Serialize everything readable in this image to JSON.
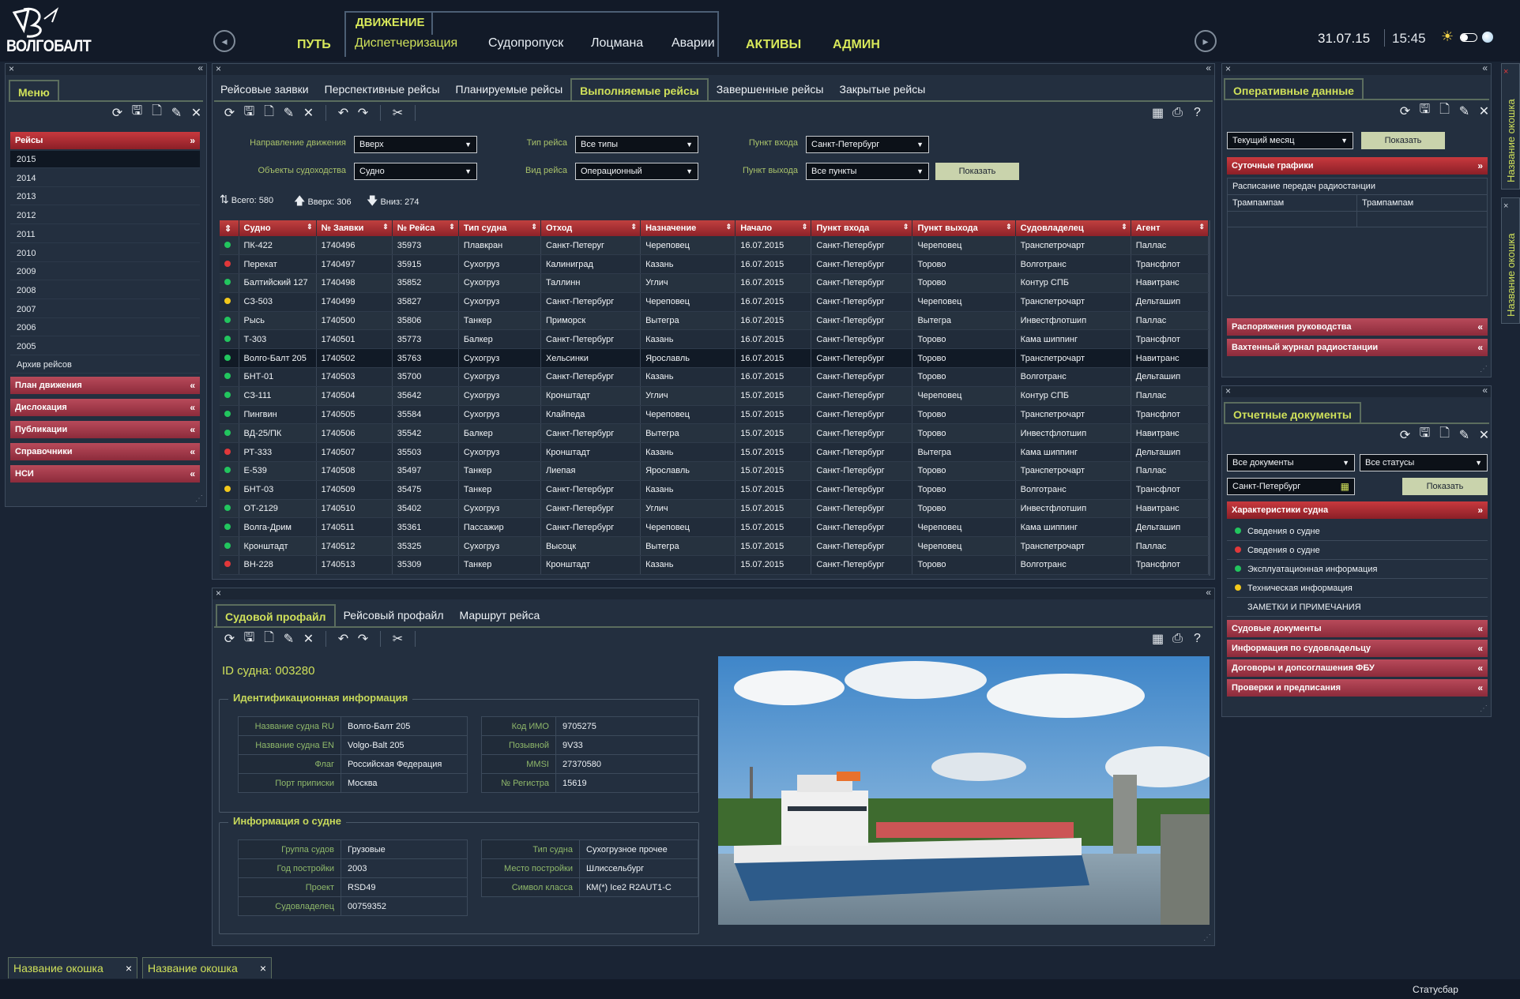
{
  "app": {
    "logo_text": "ВОЛГОБАЛТ",
    "date": "31.07.15",
    "time": "15:45"
  },
  "topnav": {
    "main": [
      "ПУТЬ",
      "АКТИВЫ",
      "АДМИН"
    ],
    "movement": {
      "label": "ДВИЖЕНИЕ",
      "subitems": [
        "Диспетчеризация",
        "Судопропуск",
        "Лоцмана",
        "Аварии"
      ]
    }
  },
  "menu": {
    "tab": "Меню",
    "trips": {
      "label": "Рейсы",
      "years": [
        "2015",
        "2014",
        "2013",
        "2012",
        "2011",
        "2010",
        "2009",
        "2008",
        "2007",
        "2006",
        "2005"
      ],
      "archive": "Архив рейсов"
    },
    "sections": [
      "План движения",
      "Дислокация",
      "Публикации",
      "Справочники",
      "НСИ"
    ]
  },
  "main": {
    "tabs": [
      "Рейсовые заявки",
      "Перспективные рейсы",
      "Планируемые рейсы",
      "Выполняемые рейсы",
      "Завершенные рейсы",
      "Закрытые рейсы"
    ],
    "active_tab": 3,
    "filters": {
      "direction_label": "Направление движения",
      "direction": "Вверх",
      "objects_label": "Объекты судоходства",
      "objects": "Судно",
      "triptype_label": "Тип рейса",
      "triptype": "Все типы",
      "tripkind_label": "Вид рейса",
      "tripkind": "Операционный",
      "entry_label": "Пункт входа",
      "entry": "Санкт-Петербург",
      "exit_label": "Пункт выхода",
      "exit": "Все пункты",
      "show": "Показать"
    },
    "counts": {
      "total": "Всего: 580",
      "up": "Вверх: 306",
      "down": "Вниз: 274"
    },
    "columns": [
      "Судно",
      "№ Заявки",
      "№ Рейса",
      "Тип судна",
      "Отход",
      "Назначение",
      "Начало",
      "Пункт входа",
      "Пункт выхода",
      "Судовладелец",
      "Агент"
    ],
    "rows": [
      {
        "s": "g",
        "c": [
          "ПК-422",
          "1740496",
          "35973",
          "Плавкран",
          "Санкт-Петеруг",
          "Череповец",
          "16.07.2015",
          "Санкт-Петербург",
          "Череповец",
          "Транспетрочарт",
          "Паллас"
        ]
      },
      {
        "s": "r",
        "c": [
          "Перекат",
          "1740497",
          "35915",
          "Сухогруз",
          "Калиниград",
          "Казань",
          "16.07.2015",
          "Санкт-Петербург",
          "Торово",
          "Волготранс",
          "Трансфлот"
        ]
      },
      {
        "s": "g",
        "c": [
          "Балтийский 127",
          "1740498",
          "35852",
          "Сухогруз",
          "Таллинн",
          "Углич",
          "16.07.2015",
          "Санкт-Петербург",
          "Торово",
          "Контур СПБ",
          "Навитранс"
        ]
      },
      {
        "s": "y",
        "c": [
          "СЗ-503",
          "1740499",
          "35827",
          "Сухогруз",
          "Санкт-Петербург",
          "Череповец",
          "16.07.2015",
          "Санкт-Петербург",
          "Череповец",
          "Транспетрочарт",
          "Дельташип"
        ]
      },
      {
        "s": "g",
        "c": [
          "Рысь",
          "1740500",
          "35806",
          "Танкер",
          "Приморск",
          "Вытегра",
          "16.07.2015",
          "Санкт-Петербург",
          "Вытегра",
          "Инвестфлотшип",
          "Паллас"
        ]
      },
      {
        "s": "g",
        "c": [
          "Т-303",
          "1740501",
          "35773",
          "Балкер",
          "Санкт-Петербург",
          "Казань",
          "16.07.2015",
          "Санкт-Петербург",
          "Торово",
          "Кама шиппинг",
          "Трансфлот"
        ]
      },
      {
        "s": "g",
        "c": [
          "Волго-Балт 205",
          "1740502",
          "35763",
          "Сухогруз",
          "Хельсинки",
          "Ярославль",
          "16.07.2015",
          "Санкт-Петербург",
          "Торово",
          "Транспетрочарт",
          "Навитранс"
        ],
        "sel": true
      },
      {
        "s": "g",
        "c": [
          "БНТ-01",
          "1740503",
          "35700",
          "Сухогруз",
          "Санкт-Петербург",
          "Казань",
          "16.07.2015",
          "Санкт-Петербург",
          "Торово",
          "Волготранс",
          "Дельташип"
        ]
      },
      {
        "s": "g",
        "c": [
          "СЗ-111",
          "1740504",
          "35642",
          "Сухогруз",
          "Кронштадт",
          "Углич",
          "15.07.2015",
          "Санкт-Петербург",
          "Череповец",
          "Контур СПБ",
          "Паллас"
        ]
      },
      {
        "s": "g",
        "c": [
          "Пингвин",
          "1740505",
          "35584",
          "Сухогруз",
          "Клайпеда",
          "Череповец",
          "15.07.2015",
          "Санкт-Петербург",
          "Торово",
          "Транспетрочарт",
          "Трансфлот"
        ]
      },
      {
        "s": "g",
        "c": [
          "ВД-25/ПК",
          "1740506",
          "35542",
          "Балкер",
          "Санкт-Петербург",
          "Вытегра",
          "15.07.2015",
          "Санкт-Петербург",
          "Торово",
          "Инвестфлотшип",
          "Навитранс"
        ]
      },
      {
        "s": "r",
        "c": [
          "РТ-333",
          "1740507",
          "35503",
          "Сухогруз",
          "Кронштадт",
          "Казань",
          "15.07.2015",
          "Санкт-Петербург",
          "Вытегра",
          "Кама шиппинг",
          "Дельташип"
        ]
      },
      {
        "s": "g",
        "c": [
          "Е-539",
          "1740508",
          "35497",
          "Танкер",
          "Лиепая",
          "Ярославль",
          "15.07.2015",
          "Санкт-Петербург",
          "Торово",
          "Транспетрочарт",
          "Паллас"
        ]
      },
      {
        "s": "y",
        "c": [
          "БНТ-03",
          "1740509",
          "35475",
          "Танкер",
          "Санкт-Петербург",
          "Казань",
          "15.07.2015",
          "Санкт-Петербург",
          "Торово",
          "Волготранс",
          "Трансфлот"
        ]
      },
      {
        "s": "g",
        "c": [
          "ОТ-2129",
          "1740510",
          "35402",
          "Сухогруз",
          "Санкт-Петербург",
          "Углич",
          "15.07.2015",
          "Санкт-Петербург",
          "Торово",
          "Инвестфлотшип",
          "Навитранс"
        ]
      },
      {
        "s": "g",
        "c": [
          "Волга-Дрим",
          "1740511",
          "35361",
          "Пассажир",
          "Санкт-Петербург",
          "Череповец",
          "15.07.2015",
          "Санкт-Петербург",
          "Череповец",
          "Кама шиппинг",
          "Дельташип"
        ]
      },
      {
        "s": "g",
        "c": [
          "Кронштадт",
          "1740512",
          "35325",
          "Сухогруз",
          "Высоцк",
          "Вытегра",
          "15.07.2015",
          "Санкт-Петербург",
          "Череповец",
          "Транспетрочарт",
          "Паллас"
        ]
      },
      {
        "s": "r",
        "c": [
          "ВН-228",
          "1740513",
          "35309",
          "Танкер",
          "Кронштадт",
          "Казань",
          "15.07.2015",
          "Санкт-Петербург",
          "Торово",
          "Волготранс",
          "Трансфлот"
        ]
      }
    ]
  },
  "detail": {
    "tabs": [
      "Судовой профайл",
      "Рейсовый профайл",
      "Маршрут рейса"
    ],
    "ship_id": "ID судна: 003280",
    "ident_title": "Идентификационная информация",
    "ident_left": [
      [
        "Название судна RU",
        "Волго-Балт 205"
      ],
      [
        "Название судна EN",
        "Volgo-Balt 205"
      ],
      [
        "Флаг",
        "Российская Федерация"
      ],
      [
        "Порт приписки",
        "Москва"
      ]
    ],
    "ident_right": [
      [
        "Код ИМО",
        "9705275"
      ],
      [
        "Позывной",
        "9V33"
      ],
      [
        "MMSI",
        "27370580"
      ],
      [
        "№ Регистра",
        "15619"
      ]
    ],
    "info_title": "Информация о судне",
    "info_left": [
      [
        "Группа судов",
        "Грузовые"
      ],
      [
        "Год постройки",
        "2003"
      ],
      [
        "Проект",
        "RSD49"
      ],
      [
        "Судовладелец",
        "00759352"
      ]
    ],
    "info_right": [
      [
        "Тип судна",
        "Сухогрузное прочее"
      ],
      [
        "Место постройки",
        "Шлиссельбург"
      ],
      [
        "Символ класса",
        "КМ(*) Ice2 R2AUT1-C"
      ]
    ]
  },
  "oper": {
    "tab": "Оперативные данные",
    "period": "Текущий месяц",
    "show": "Показать",
    "daily": "Суточные графики",
    "schedule": "Расписание передач радиостанции",
    "cells": [
      "Трампампам",
      "Трампампам"
    ],
    "orders": "Распоряжения руководства",
    "journal": "Вахтенный журнал радиостанции"
  },
  "reports": {
    "tab": "Отчетные документы",
    "docs": "Все документы",
    "statuses": "Все статусы",
    "place": "Санкт-Петербург",
    "show": "Показать",
    "chars": "Характеристики судна",
    "items": [
      {
        "s": "g",
        "t": "Сведения о судне"
      },
      {
        "s": "r",
        "t": "Сведения о судне"
      },
      {
        "s": "g",
        "t": "Эксплуатационная информация"
      },
      {
        "s": "y",
        "t": "Техническая информация"
      },
      {
        "s": "",
        "t": "ЗАМЕТКИ И ПРИМЕЧАНИЯ"
      }
    ],
    "sections": [
      "Судовые документы",
      "Информация по судовладельцу",
      "Договоры и допсоглашения ФБУ",
      "Проверки и предписания"
    ]
  },
  "bottom": {
    "windows": [
      "Название окошка",
      "Название окошка"
    ],
    "side_windows": [
      "Название окошка",
      "Название окошка"
    ],
    "status": "Статусбар"
  },
  "colors": {
    "accent": "#cfe05a",
    "red": "#a83446",
    "bg": "#1a2434",
    "panel": "#232f3f"
  }
}
